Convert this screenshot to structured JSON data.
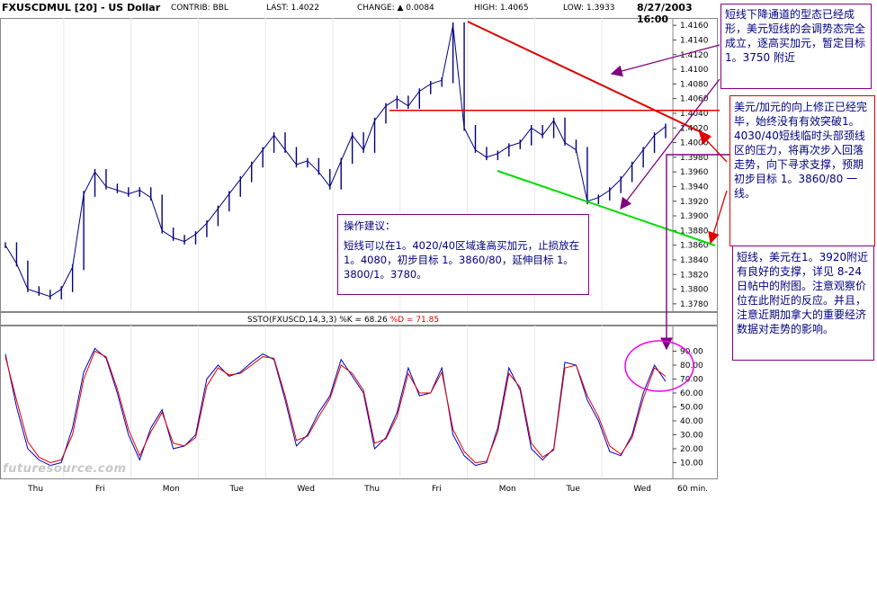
{
  "header": {
    "symbol": "FXUSCDMUL [20] - US Dollar",
    "contrib": "CONTRIB: BBL",
    "last": "LAST: 1.4022",
    "change": "CHANGE: ▲ 0.0084",
    "high": "HIGH: 1.4065",
    "low": "LOW: 1.3933",
    "datetime": "8/27/2003 16:00"
  },
  "chart_data": [
    {
      "type": "line",
      "name": "price",
      "x_labels": [
        "Thu",
        "Fri",
        "Mon",
        "Tue",
        "Wed",
        "Thu",
        "Fri",
        "Mon",
        "Tue",
        "Wed"
      ],
      "x_interval": "60 min.",
      "y_ticks": [
        "1.4160",
        "1.4140",
        "1.4120",
        "1.4100",
        "1.4080",
        "1.4060",
        "1.4040",
        "1.4020",
        "1.4000",
        "1.3980",
        "1.3960",
        "1.3940",
        "1.3920",
        "1.3900",
        "1.3880",
        "1.3860",
        "1.3840",
        "1.3820",
        "1.3800",
        "1.3780"
      ],
      "ylim": [
        1.377,
        1.417
      ],
      "values": [
        1.386,
        1.3835,
        1.38,
        1.3795,
        1.379,
        1.38,
        1.383,
        1.393,
        1.396,
        1.394,
        1.3935,
        1.393,
        1.3935,
        1.3925,
        1.388,
        1.387,
        1.3865,
        1.3875,
        1.389,
        1.391,
        1.393,
        1.395,
        1.397,
        1.399,
        1.401,
        1.399,
        1.397,
        1.3975,
        1.396,
        1.394,
        1.3975,
        1.401,
        1.399,
        1.403,
        1.405,
        1.406,
        1.405,
        1.407,
        1.408,
        1.4085,
        1.416,
        1.402,
        1.399,
        1.398,
        1.3985,
        1.3995,
        1.4,
        1.402,
        1.401,
        1.403,
        1.4,
        1.399,
        1.392,
        1.3925,
        1.3935,
        1.395,
        1.397,
        1.399,
        1.401,
        1.4022
      ],
      "high": 1.4065,
      "low": 1.3933
    },
    {
      "type": "line",
      "name": "stochastic",
      "title": "SSTO(FXUSCD,14,3,3) %K = 68.26 %D = 71.85",
      "series": [
        {
          "name": "%K",
          "color": "#0000c8",
          "values": [
            88,
            50,
            20,
            12,
            8,
            10,
            35,
            75,
            92,
            85,
            60,
            30,
            12,
            35,
            48,
            20,
            22,
            30,
            70,
            80,
            72,
            75,
            82,
            88,
            84,
            55,
            22,
            30,
            46,
            58,
            84,
            72,
            60,
            20,
            28,
            46,
            78,
            58,
            60,
            78,
            30,
            15,
            8,
            10,
            35,
            78,
            62,
            20,
            12,
            20,
            82,
            80,
            55,
            40,
            18,
            15,
            30,
            60,
            80,
            68.26
          ]
        },
        {
          "name": "%D",
          "color": "#e00000",
          "values": [
            86,
            55,
            25,
            14,
            10,
            12,
            30,
            70,
            90,
            86,
            63,
            34,
            15,
            32,
            46,
            24,
            22,
            28,
            65,
            78,
            73,
            74,
            80,
            86,
            85,
            58,
            26,
            29,
            43,
            56,
            80,
            74,
            62,
            24,
            27,
            43,
            74,
            60,
            60,
            75,
            34,
            18,
            10,
            11,
            32,
            74,
            64,
            24,
            14,
            19,
            78,
            80,
            58,
            43,
            22,
            16,
            28,
            56,
            78,
            71.85
          ]
        }
      ],
      "y_ticks": [
        "90.00",
        "80.00",
        "70.00",
        "60.00",
        "50.00",
        "40.00",
        "30.00",
        "20.00",
        "10.00"
      ],
      "ylim": [
        0,
        100
      ]
    }
  ],
  "annotations": {
    "note_1": "短线下降通道的型态已经成形，美元短线的会调势态完全成立，逐高买加元，暂定目标 1。3750 附近",
    "note_2": "美元/加元的向上修正已经完毕，始终没有有效突破1。4030/40短线临时头部颈线区的压力，将再次步入回落走势，向下寻求支撑，预期初步目标 1。3860/80 一线。",
    "note_3": "短线，美元在1。3920附近有良好的支撑，详见 8-24 日帖中的附图。注意观察价位在此附近的反应。并且，注意近期加拿大的重要经济数据对走势的影响。",
    "advice_title": "操作建议：",
    "advice_body": "短线可以在1。4020/40区域逢高买加元，止损放在1。4080，初步目标 1。3860/80，延伸目标 1。3800/1。3780。"
  },
  "watermark": "futuresource.com",
  "colors": {
    "price": "#000080",
    "channel_top": "#e00000",
    "channel_bottom": "#00dd00",
    "neckline": "#e00000",
    "arrows": "#800080",
    "circle": "#ee00ee"
  }
}
